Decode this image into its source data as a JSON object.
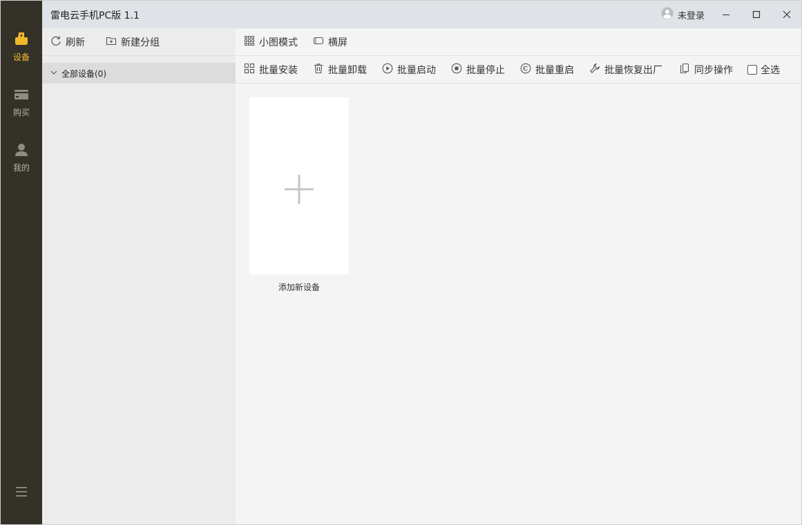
{
  "app": {
    "title": "雷电云手机PC版 1.1"
  },
  "colors": {
    "rail_bg": "#343128",
    "accent": "#f0b92c",
    "titlebar_bg": "#dfe2e6"
  },
  "rail": {
    "items": [
      {
        "label": "设备",
        "icon": "device-icon",
        "active": true
      },
      {
        "label": "购买",
        "icon": "card-icon",
        "active": false
      },
      {
        "label": "我的",
        "icon": "user-icon",
        "active": false
      }
    ],
    "menu_icon": "menu-icon"
  },
  "titlebar": {
    "login_label": "未登录",
    "buttons": [
      "minimize-icon",
      "maximize-icon",
      "close-icon"
    ]
  },
  "group_panel": {
    "refresh_label": "刷新",
    "new_group_label": "新建分组",
    "groups": [
      {
        "label": "全部设备(0)",
        "expanded": true
      }
    ]
  },
  "main": {
    "view_toolbar": {
      "small_mode_label": "小图模式",
      "landscape_label": "横屏"
    },
    "batch_toolbar": {
      "install_label": "批量安装",
      "uninstall_label": "批量卸载",
      "start_label": "批量启动",
      "stop_label": "批量停止",
      "restart_label": "批量重启",
      "reset_label": "批量恢复出厂",
      "sync_label": "同步操作",
      "select_all_label": "全选"
    },
    "add_device_label": "添加新设备"
  }
}
